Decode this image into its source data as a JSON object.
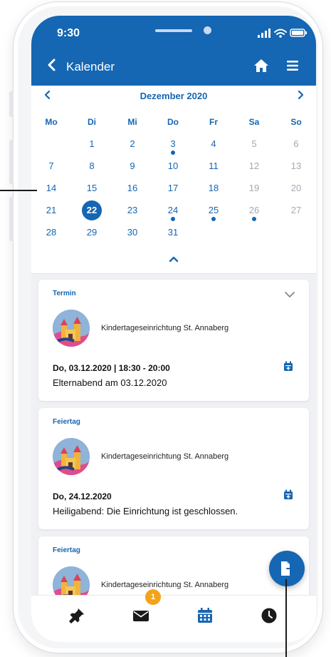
{
  "status": {
    "time": "9:30"
  },
  "header": {
    "title": "Kalender",
    "back_icon": "chevron-left-icon",
    "home_icon": "home-icon",
    "menu_icon": "menu-icon"
  },
  "calendar": {
    "month_label": "Dezember 2020",
    "prev_icon": "chevron-left-icon",
    "next_icon": "chevron-right-icon",
    "weekdays": [
      "Mo",
      "Di",
      "Mi",
      "Do",
      "Fr",
      "Sa",
      "So"
    ],
    "weeks": [
      [
        "",
        "1",
        "2",
        "3",
        "4",
        "5",
        "6"
      ],
      [
        "7",
        "8",
        "9",
        "10",
        "11",
        "12",
        "13"
      ],
      [
        "14",
        "15",
        "16",
        "17",
        "18",
        "19",
        "20"
      ],
      [
        "21",
        "22",
        "23",
        "24",
        "25",
        "26",
        "27"
      ],
      [
        "28",
        "29",
        "30",
        "31",
        "",
        "",
        ""
      ]
    ],
    "selected_day": "22",
    "event_days": [
      "3",
      "24",
      "25",
      "26"
    ],
    "collapse_icon": "chevron-up-icon"
  },
  "events": [
    {
      "type": "Termin",
      "organization": "Kindertageseinrichtung St. Annaberg",
      "date_time": "Do, 03.12.2020 | 18:30 - 20:00",
      "title": "Elternabend am 03.12.2020",
      "expand_icon": "chevron-down-icon"
    },
    {
      "type": "Feiertag",
      "organization": "Kindertageseinrichtung St. Annaberg",
      "date_time": "Do, 24.12.2020",
      "title": "Heiligabend: Die Einrichtung ist geschlossen."
    },
    {
      "type": "Feiertag",
      "organization": "Kindertageseinrichtung St. Annaberg",
      "date_time": "",
      "title": ""
    }
  ],
  "fab": {
    "icon": "export-document-icon"
  },
  "tabbar": {
    "items": [
      {
        "icon": "pin-icon"
      },
      {
        "icon": "mail-icon",
        "badge": "1"
      },
      {
        "icon": "calendar-icon",
        "active": true
      },
      {
        "icon": "clock-icon"
      }
    ]
  },
  "colors": {
    "primary": "#1566b3",
    "badge": "#f5a21b",
    "muted_weekend": "#a5a9b1",
    "background": "#f0f1f4"
  }
}
